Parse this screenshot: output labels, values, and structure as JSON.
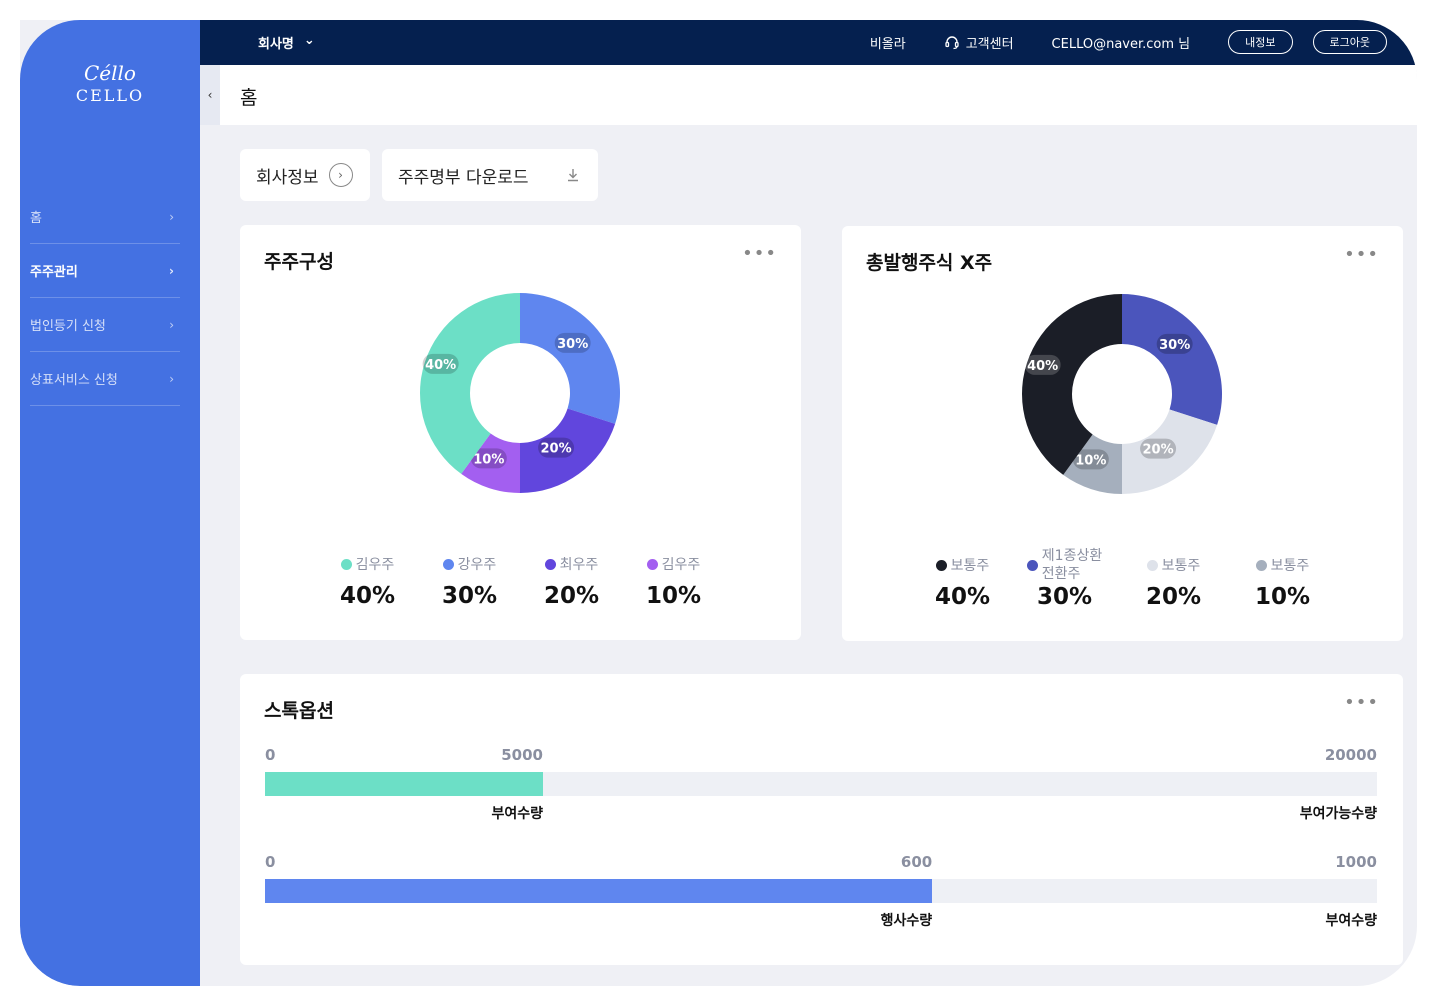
{
  "brand": {
    "logo_mark": "Céllo",
    "logo_text": "CELLO"
  },
  "sidebar": {
    "items": [
      {
        "label": "홈",
        "active": false
      },
      {
        "label": "주주관리",
        "active": true
      },
      {
        "label": "법인등기 신청",
        "active": false
      },
      {
        "label": "상표서비스 신청",
        "active": false
      }
    ]
  },
  "topbar": {
    "company": "회사명",
    "link1": "비올라",
    "support": "고객센터",
    "user": "CELLO@naver.com 님",
    "my_info": "내정보",
    "logout": "로그아웃"
  },
  "header": {
    "title": "홈"
  },
  "actions": {
    "company_info": "회사정보",
    "download": "주주명부 다운로드"
  },
  "colors": {
    "sidebar": "#4471e2",
    "topbar": "#05204f",
    "teal": "#6cdfc6",
    "blue": "#5f86ef",
    "indigo": "#6146dd",
    "violet": "#a35ff0",
    "navy": "#1b1e27",
    "slate": "#4b55bc",
    "light": "#dee2ea",
    "grey": "#a5afbd"
  },
  "chart_data": [
    {
      "type": "pie",
      "title": "주주구성",
      "labels": [
        "김우주",
        "강우주",
        "최우주",
        "김우주"
      ],
      "values": [
        40,
        30,
        20,
        10
      ],
      "value_labels": [
        "40%",
        "30%",
        "20%",
        "10%"
      ]
    },
    {
      "type": "pie",
      "title": "총발행주식 X주",
      "labels": [
        "보통주",
        "제1종상환\n전환주",
        "보통주",
        "보통주"
      ],
      "values": [
        40,
        30,
        20,
        10
      ],
      "value_labels": [
        "40%",
        "30%",
        "20%",
        "10%"
      ]
    },
    {
      "type": "bar",
      "title": "스톡옵션",
      "bars": [
        {
          "min": 0,
          "max": 20000,
          "value": 5000,
          "tick_labels": [
            "0",
            "5000",
            "20000"
          ],
          "value_label": "부여수량",
          "max_label": "부여가능수량"
        },
        {
          "min": 0,
          "max": 1000,
          "value": 600,
          "tick_labels": [
            "0",
            "600",
            "1000"
          ],
          "value_label": "행사수량",
          "max_label": "부여수량"
        }
      ]
    }
  ]
}
